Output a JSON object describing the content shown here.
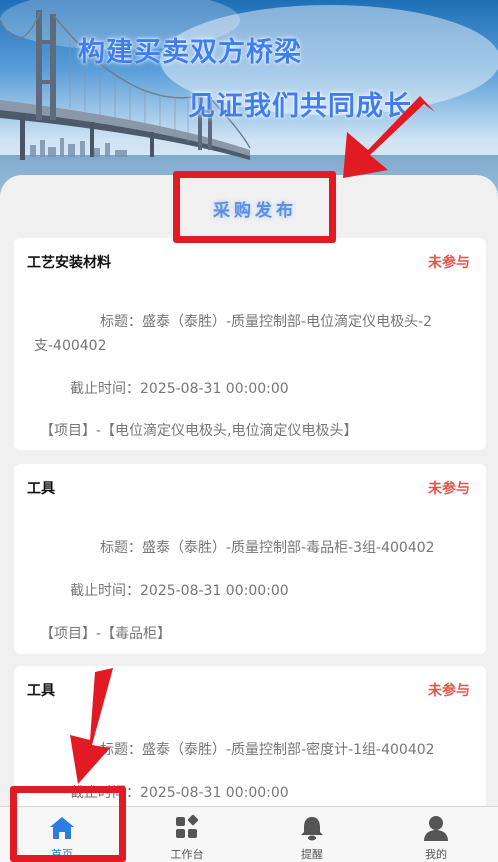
{
  "banner": {
    "line1": "构建买卖双方桥梁",
    "line2": "见证我们共同成长"
  },
  "section": {
    "title": "采购发布"
  },
  "purchases": [
    {
      "category": "工艺安装材料",
      "status": "未参与",
      "title": "标题：盛泰（泰胜）-质量控制部-电位滴定仪电极头-2支-400402",
      "deadline": "截止时间：2025-08-31 00:00:00",
      "project": "【项目】-【电位滴定仪电极头,电位滴定仪电极头】"
    },
    {
      "category": "工具",
      "status": "未参与",
      "title": "标题：盛泰（泰胜）-质量控制部-毒品柜-3组-400402",
      "deadline": "截止时间：2025-08-31 00:00:00",
      "project": "【项目】-【毒品柜】"
    },
    {
      "category": "工具",
      "status": "未参与",
      "title": "标题：盛泰（泰胜）-质量控制部-密度计-1组-400402",
      "deadline": "截止时间：2025-08-31 00:00:00",
      "project": ""
    }
  ],
  "tabbar": {
    "items": [
      {
        "label": "首页",
        "icon": "home-icon",
        "active": true
      },
      {
        "label": "工作台",
        "icon": "workbench-icon",
        "active": false
      },
      {
        "label": "提醒",
        "icon": "bell-icon",
        "active": false
      },
      {
        "label": "我的",
        "icon": "user-icon",
        "active": false
      }
    ]
  },
  "colors": {
    "accent": "#2a7de1",
    "status": "#e5534b",
    "annotation": "#e21a23"
  }
}
